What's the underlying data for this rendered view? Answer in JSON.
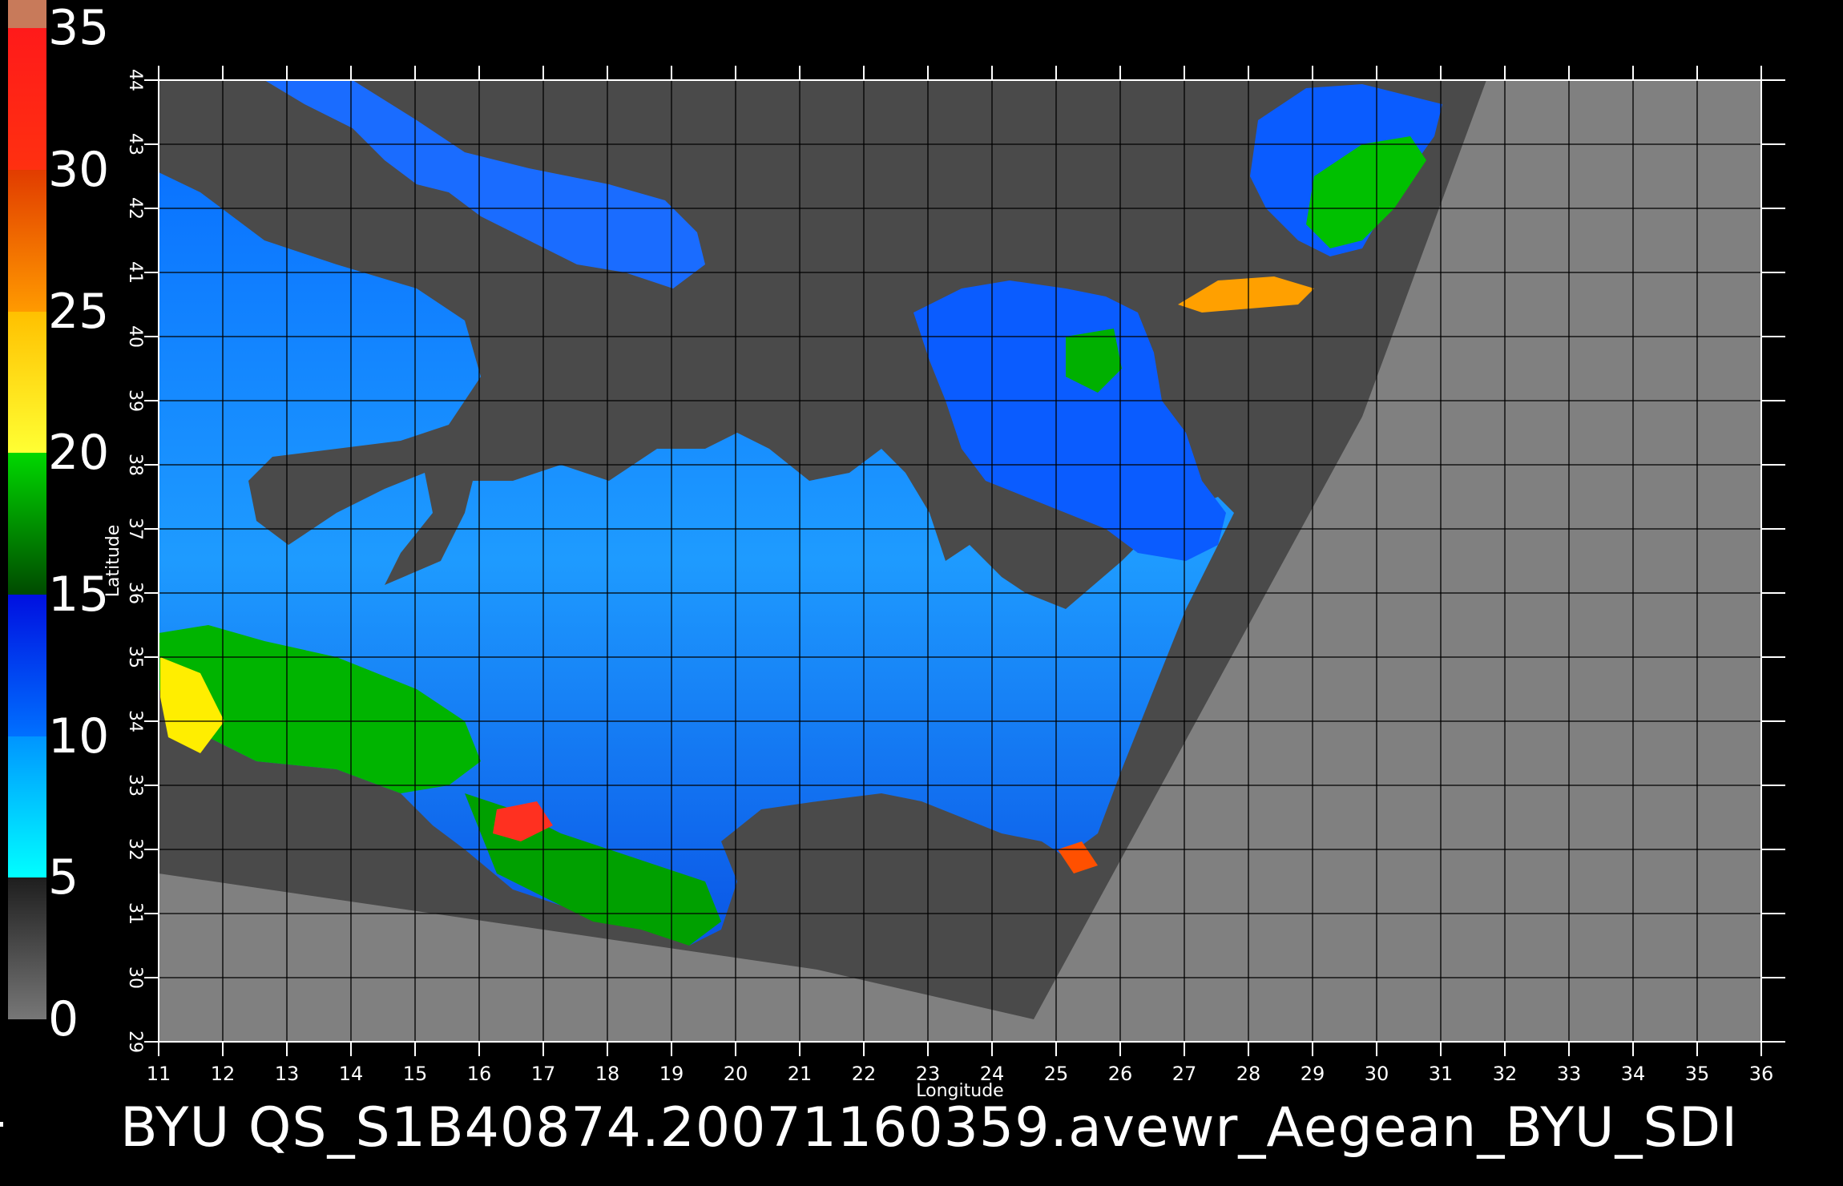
{
  "title": "BYU  QS_S1B40874.20071160359.avewr_Aegean_BYU_SDI",
  "colorbar": {
    "tick_labels": [
      "35",
      "30",
      "25",
      "20",
      "15",
      "10",
      "5",
      "0"
    ],
    "segments": [
      {
        "from": 0,
        "to": 5,
        "color_bottom": "#777777",
        "color_top": "#1e1e1e"
      },
      {
        "from": 5,
        "to": 10,
        "color_bottom": "#00ffff",
        "color_top": "#0095ff"
      },
      {
        "from": 10,
        "to": 15,
        "color_bottom": "#0070ff",
        "color_top": "#0010e0"
      },
      {
        "from": 15,
        "to": 20,
        "color_bottom": "#004a00",
        "color_top": "#00d800"
      },
      {
        "from": 20,
        "to": 25,
        "color_bottom": "#ffff33",
        "color_top": "#ffc000"
      },
      {
        "from": 25,
        "to": 30,
        "color_bottom": "#ff9a00",
        "color_top": "#e13c00"
      },
      {
        "from": 30,
        "to": 35,
        "color_bottom": "#ff3010",
        "color_top": "#ff1a1a"
      },
      {
        "from": 35,
        "to": 36,
        "color_bottom": "#c87a5a",
        "color_top": "#c87a5a"
      }
    ]
  },
  "map": {
    "x_axis_label": "Longitude",
    "y_axis_label": "Latitude",
    "lon_ticks": [
      "11",
      "12",
      "13",
      "14",
      "15",
      "16",
      "17",
      "18",
      "19",
      "20",
      "21",
      "22",
      "23",
      "24",
      "25",
      "26",
      "27",
      "28",
      "29",
      "30",
      "31",
      "32",
      "33",
      "34",
      "35",
      "36"
    ],
    "lat_ticks": [
      "29",
      "30",
      "31",
      "32",
      "33",
      "34",
      "35",
      "36",
      "37",
      "38",
      "39",
      "40",
      "41",
      "42",
      "43",
      "44"
    ],
    "lon_range": [
      11,
      36
    ],
    "lat_range": [
      29,
      44
    ],
    "grid": true,
    "colors": {
      "outside_swath": "#808080",
      "land_in_swath": "#4a4a4a",
      "grid": "#000000"
    }
  }
}
